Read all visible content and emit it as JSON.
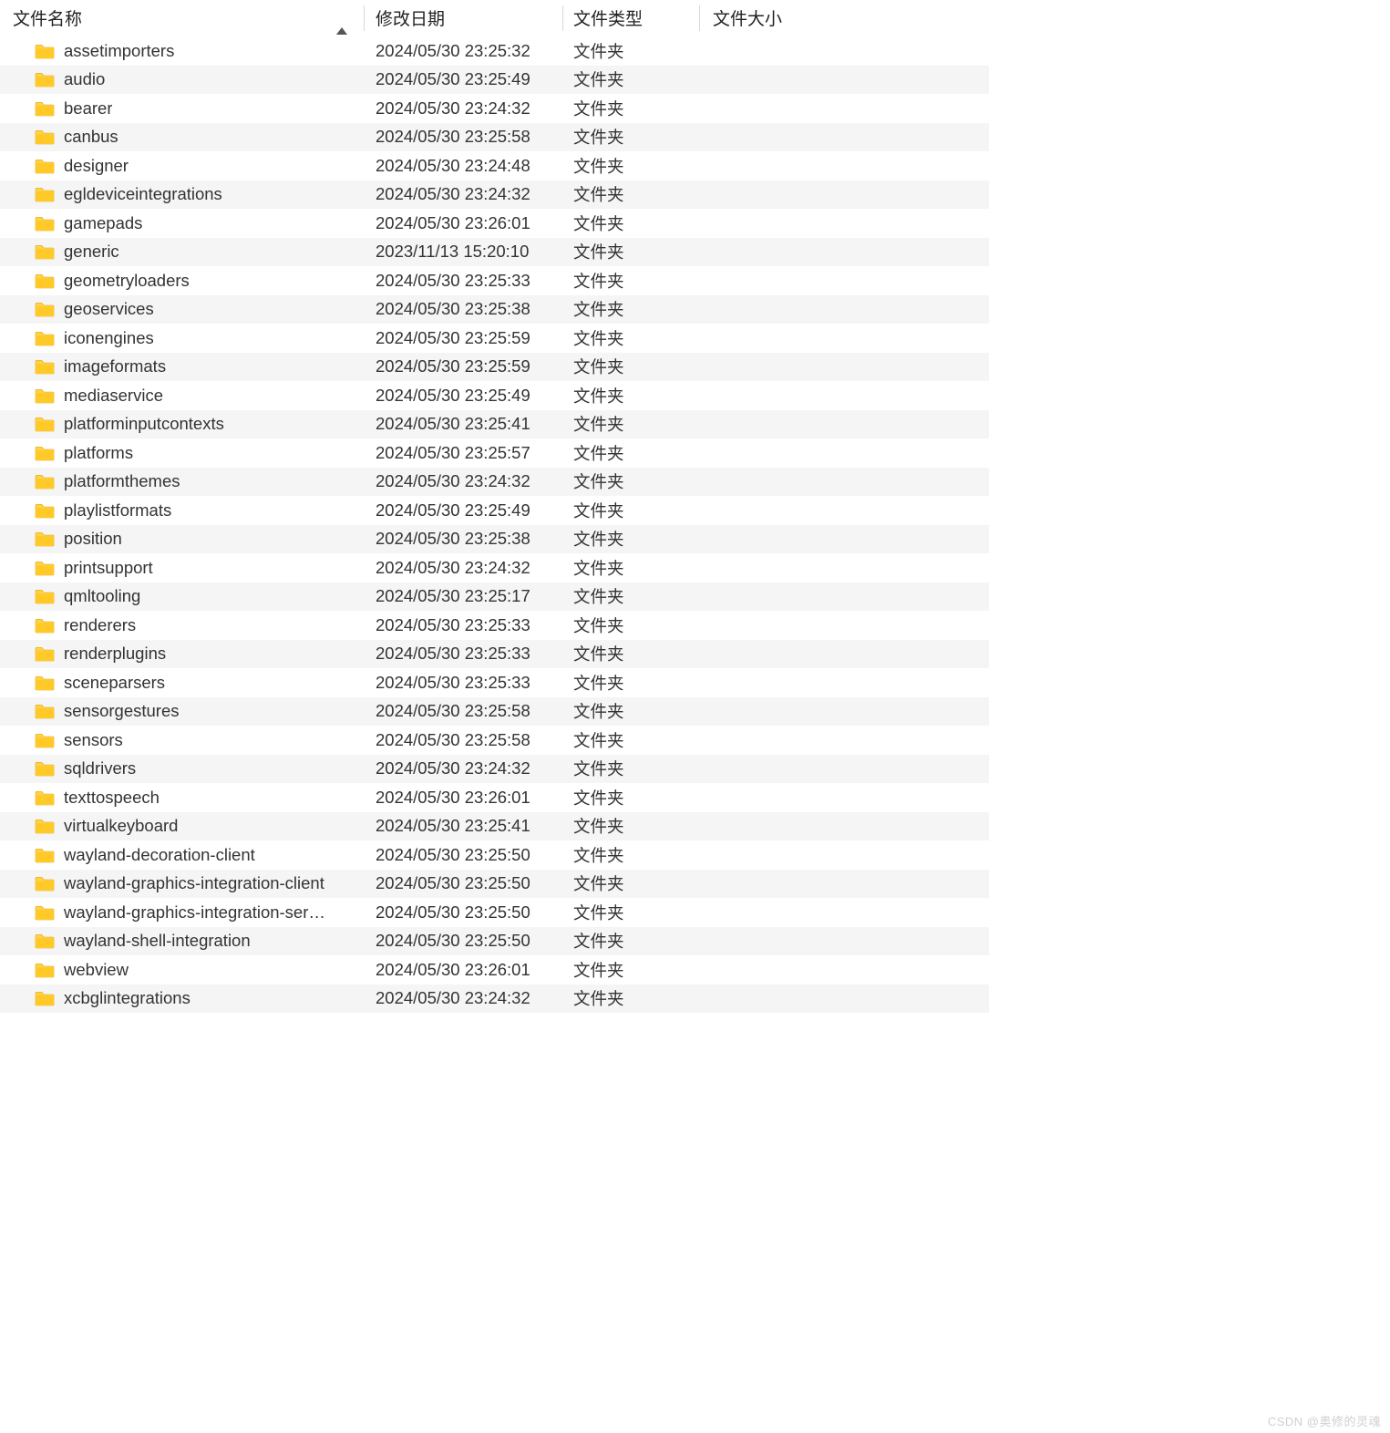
{
  "columns": {
    "name": "文件名称",
    "date": "修改日期",
    "type": "文件类型",
    "size": "文件大小"
  },
  "rows": [
    {
      "name": "assetimporters",
      "date": "2024/05/30 23:25:32",
      "type": "文件夹",
      "size": ""
    },
    {
      "name": "audio",
      "date": "2024/05/30 23:25:49",
      "type": "文件夹",
      "size": ""
    },
    {
      "name": "bearer",
      "date": "2024/05/30 23:24:32",
      "type": "文件夹",
      "size": ""
    },
    {
      "name": "canbus",
      "date": "2024/05/30 23:25:58",
      "type": "文件夹",
      "size": ""
    },
    {
      "name": "designer",
      "date": "2024/05/30 23:24:48",
      "type": "文件夹",
      "size": ""
    },
    {
      "name": "egldeviceintegrations",
      "date": "2024/05/30 23:24:32",
      "type": "文件夹",
      "size": ""
    },
    {
      "name": "gamepads",
      "date": "2024/05/30 23:26:01",
      "type": "文件夹",
      "size": ""
    },
    {
      "name": "generic",
      "date": "2023/11/13 15:20:10",
      "type": "文件夹",
      "size": ""
    },
    {
      "name": "geometryloaders",
      "date": "2024/05/30 23:25:33",
      "type": "文件夹",
      "size": ""
    },
    {
      "name": "geoservices",
      "date": "2024/05/30 23:25:38",
      "type": "文件夹",
      "size": ""
    },
    {
      "name": "iconengines",
      "date": "2024/05/30 23:25:59",
      "type": "文件夹",
      "size": ""
    },
    {
      "name": "imageformats",
      "date": "2024/05/30 23:25:59",
      "type": "文件夹",
      "size": ""
    },
    {
      "name": "mediaservice",
      "date": "2024/05/30 23:25:49",
      "type": "文件夹",
      "size": ""
    },
    {
      "name": "platforminputcontexts",
      "date": "2024/05/30 23:25:41",
      "type": "文件夹",
      "size": ""
    },
    {
      "name": "platforms",
      "date": "2024/05/30 23:25:57",
      "type": "文件夹",
      "size": ""
    },
    {
      "name": "platformthemes",
      "date": "2024/05/30 23:24:32",
      "type": "文件夹",
      "size": ""
    },
    {
      "name": "playlistformats",
      "date": "2024/05/30 23:25:49",
      "type": "文件夹",
      "size": ""
    },
    {
      "name": "position",
      "date": "2024/05/30 23:25:38",
      "type": "文件夹",
      "size": ""
    },
    {
      "name": "printsupport",
      "date": "2024/05/30 23:24:32",
      "type": "文件夹",
      "size": ""
    },
    {
      "name": "qmltooling",
      "date": "2024/05/30 23:25:17",
      "type": "文件夹",
      "size": ""
    },
    {
      "name": "renderers",
      "date": "2024/05/30 23:25:33",
      "type": "文件夹",
      "size": ""
    },
    {
      "name": "renderplugins",
      "date": "2024/05/30 23:25:33",
      "type": "文件夹",
      "size": ""
    },
    {
      "name": "sceneparsers",
      "date": "2024/05/30 23:25:33",
      "type": "文件夹",
      "size": ""
    },
    {
      "name": "sensorgestures",
      "date": "2024/05/30 23:25:58",
      "type": "文件夹",
      "size": ""
    },
    {
      "name": "sensors",
      "date": "2024/05/30 23:25:58",
      "type": "文件夹",
      "size": ""
    },
    {
      "name": "sqldrivers",
      "date": "2024/05/30 23:24:32",
      "type": "文件夹",
      "size": ""
    },
    {
      "name": "texttospeech",
      "date": "2024/05/30 23:26:01",
      "type": "文件夹",
      "size": ""
    },
    {
      "name": "virtualkeyboard",
      "date": "2024/05/30 23:25:41",
      "type": "文件夹",
      "size": ""
    },
    {
      "name": "wayland-decoration-client",
      "date": "2024/05/30 23:25:50",
      "type": "文件夹",
      "size": ""
    },
    {
      "name": "wayland-graphics-integration-client",
      "date": "2024/05/30 23:25:50",
      "type": "文件夹",
      "size": ""
    },
    {
      "name": "wayland-graphics-integration-ser…",
      "date": "2024/05/30 23:25:50",
      "type": "文件夹",
      "size": ""
    },
    {
      "name": "wayland-shell-integration",
      "date": "2024/05/30 23:25:50",
      "type": "文件夹",
      "size": ""
    },
    {
      "name": "webview",
      "date": "2024/05/30 23:26:01",
      "type": "文件夹",
      "size": ""
    },
    {
      "name": "xcbglintegrations",
      "date": "2024/05/30 23:24:32",
      "type": "文件夹",
      "size": ""
    }
  ],
  "watermark": "CSDN @奥修的灵魂"
}
